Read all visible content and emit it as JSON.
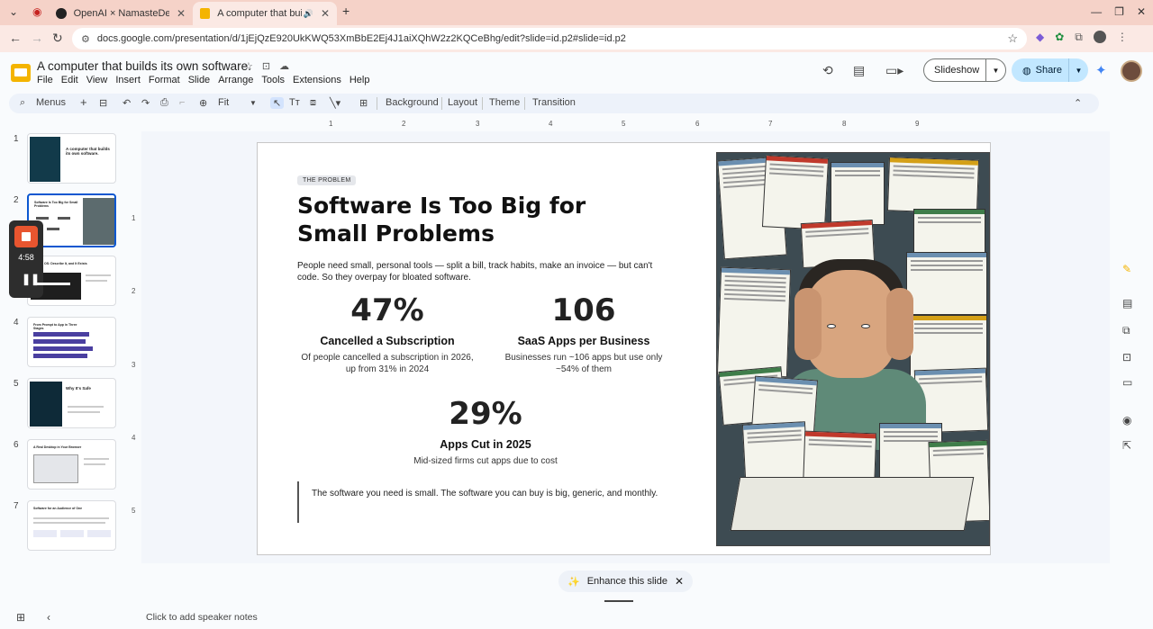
{
  "browser": {
    "tabs": [
      {
        "label": "OpenAI × NamasteDev.c"
      },
      {
        "label": "A computer that builds"
      }
    ],
    "url": "docs.google.com/presentation/d/1jEjQzE920UkKWQ53XmBbE2Ej4J1aiXQhW2z2KQCeBhg/edit?slide=id.p2#slide=id.p2"
  },
  "doc": {
    "title": "A computer that builds its own software.",
    "menus": [
      "File",
      "Edit",
      "View",
      "Insert",
      "Format",
      "Slide",
      "Arrange",
      "Tools",
      "Extensions",
      "Help"
    ],
    "slideshow_label": "Slideshow",
    "share_label": "Share"
  },
  "toolbar": {
    "menus_label": "Menus",
    "zoom_label": "Fit",
    "background_label": "Background",
    "layout_label": "Layout",
    "theme_label": "Theme",
    "transition_label": "Transition"
  },
  "ruler": {
    "h_ticks": [
      "1",
      "2",
      "3",
      "4",
      "5",
      "6",
      "7",
      "8",
      "9"
    ],
    "v_ticks": [
      "1",
      "2",
      "3",
      "4",
      "5"
    ]
  },
  "recorder": {
    "time": "4:58"
  },
  "filmstrip": {
    "slides": [
      {
        "num": "1",
        "title": "A computer that builds its own software."
      },
      {
        "num": "2",
        "title": "Software Is Too Big for Small Problems"
      },
      {
        "num": "3",
        "title": "OS: Describe It, and It Exists"
      },
      {
        "num": "4",
        "title": "From Prompt to App in Three Stages"
      },
      {
        "num": "5",
        "title": "Why It's Safe"
      },
      {
        "num": "6",
        "title": "A Real Desktop in Your Browser"
      },
      {
        "num": "7",
        "title": "Software for an Audience of One"
      }
    ]
  },
  "slide": {
    "badge": "THE PROBLEM",
    "headline": "Software Is Too Big for Small Problems",
    "intro": "People need small, personal tools — split a bill, track habits, make an invoice — but can't code. So they overpay for bloated software.",
    "stats": [
      {
        "num": "47%",
        "label": "Cancelled a Subscription",
        "desc": "Of people cancelled a subscription in 2026, up from 31% in 2024"
      },
      {
        "num": "106",
        "label": "SaaS Apps per Business",
        "desc": "Businesses run ~106 apps but use only ~54% of them"
      },
      {
        "num": "29%",
        "label": "Apps Cut in 2025",
        "desc": "Mid-sized firms cut apps due to cost"
      }
    ],
    "quote": "The software you need is small. The software you can buy is big, generic, and monthly."
  },
  "enhance": {
    "label": "Enhance this slide"
  },
  "notes": {
    "placeholder": "Click to add speaker notes"
  },
  "colors": {
    "tabstrip": "#f5d2c8",
    "accent": "#0b57d0",
    "share": "#c2e7ff",
    "recorder_stop": "#e8552f"
  }
}
